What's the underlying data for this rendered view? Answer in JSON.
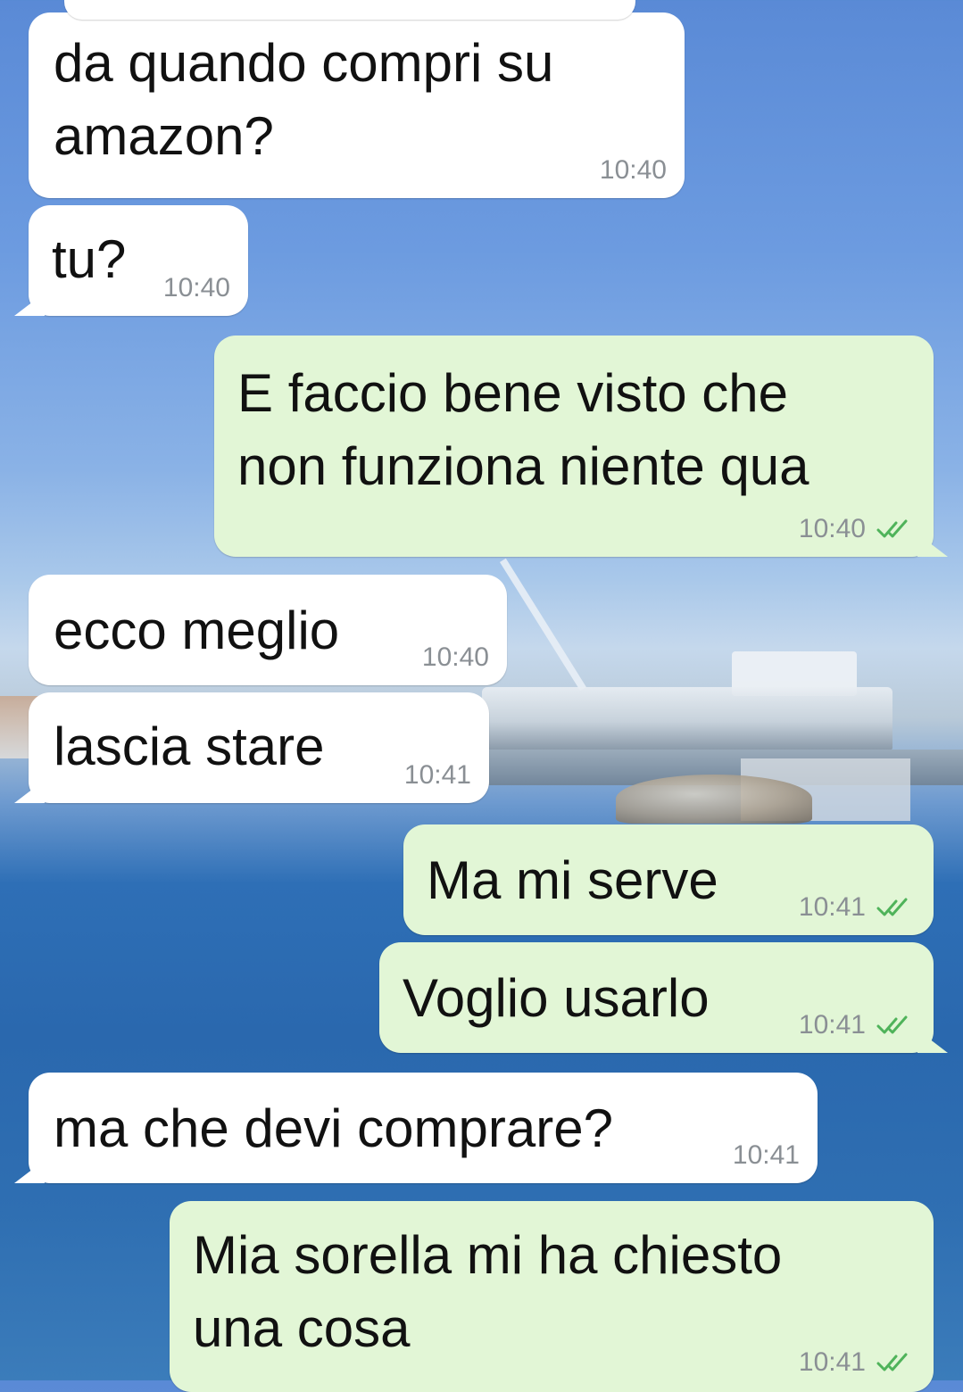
{
  "messages": [
    {
      "direction": "in",
      "text_lines": [
        "da quando compri su",
        "amazon?"
      ],
      "time": "10:40"
    },
    {
      "direction": "in",
      "text_lines": [
        "tu?"
      ],
      "time": "10:40"
    },
    {
      "direction": "out",
      "text_lines": [
        "E faccio bene visto che",
        "non funziona niente qua"
      ],
      "time": "10:40",
      "read": true
    },
    {
      "direction": "in",
      "text_lines": [
        "ecco meglio"
      ],
      "time": "10:40"
    },
    {
      "direction": "in",
      "text_lines": [
        "lascia stare"
      ],
      "time": "10:41"
    },
    {
      "direction": "out",
      "text_lines": [
        "Ma mi serve"
      ],
      "time": "10:41",
      "read": true
    },
    {
      "direction": "out",
      "text_lines": [
        "Voglio usarlo"
      ],
      "time": "10:41",
      "read": true
    },
    {
      "direction": "in",
      "text_lines": [
        "ma che devi comprare?"
      ],
      "time": "10:41"
    },
    {
      "direction": "out",
      "text_lines": [
        "Mia sorella mi ha chiesto",
        "una cosa"
      ],
      "time": "10:41",
      "read": true
    }
  ],
  "colors": {
    "incoming_bubble": "#ffffff",
    "outgoing_bubble": "#e2f6d6",
    "timestamp": "#8a8f94",
    "read_ticks": "#4fb35a"
  },
  "icons": {
    "read_receipt": "double-check-icon"
  }
}
